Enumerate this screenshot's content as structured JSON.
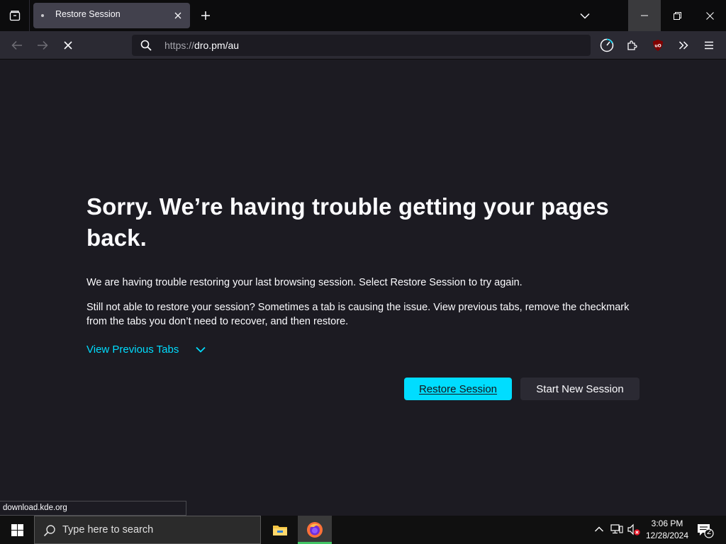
{
  "browser": {
    "tab_title": "Restore Session",
    "url_scheme": "https://",
    "url_host": "dro.pm/au"
  },
  "page": {
    "headline": "Sorry. We’re having trouble getting your pages back.",
    "para1": "We are having trouble restoring your last browsing session. Select Restore Session to try again.",
    "para2": "Still not able to restore your session? Sometimes a tab is causing the issue. View previous tabs, remove the checkmark from the tabs you don’t need to recover, and then restore.",
    "view_previous_tabs": "View Previous Tabs",
    "restore_button_label": "Restore Session",
    "new_session_button_label": "Start New Session"
  },
  "status_bar": {
    "link": "download.kde.org"
  },
  "taskbar": {
    "search_placeholder": "Type here to search",
    "time": "3:06 PM",
    "date": "12/28/2024",
    "notification_count": "2"
  },
  "colors": {
    "accent": "#00ddff",
    "page_background": "#1c1b22",
    "toolbar": "#2b2a33",
    "tabstrip": "#0c0c0d",
    "ublock_red": "#800000"
  }
}
